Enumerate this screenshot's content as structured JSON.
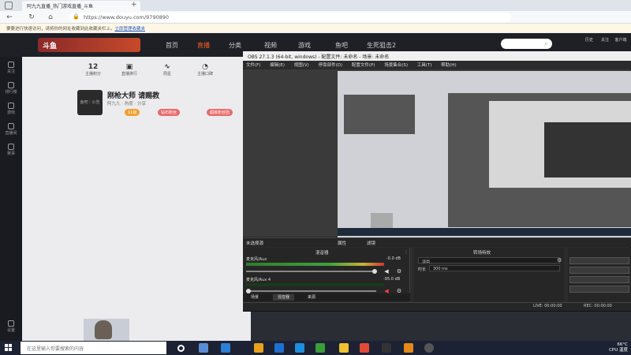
{
  "browser": {
    "tab_title": "阿九九直播_热门游戏直播_斗鱼",
    "url": "https://www.douyu.com/9790890",
    "notice_text": "要要进行快速访问，请将你的网址收藏到此收藏夹栏上。",
    "notice_link": "立即管理收藏夹"
  },
  "douyu": {
    "logo": "斗鱼",
    "nav": [
      "首页",
      "直播",
      "分类",
      "视频",
      "游戏",
      "鱼吧",
      "生死狙击2"
    ],
    "search_placeholder": "",
    "sidebar": [
      "关注",
      "排行榜",
      "游戏",
      "直播间",
      "赛事",
      "设置"
    ],
    "stats": [
      {
        "value": "12",
        "label": "主播积分"
      },
      {
        "value": "",
        "label": "直播排行"
      },
      {
        "value": "",
        "label": "周星"
      },
      {
        "value": "",
        "label": "主播口碑"
      }
    ],
    "room_title": "刚枪大师 请赐教",
    "room_sub": "阿九九  ·  热度  ·  分享",
    "avatar_text": "鱼吧｜公告",
    "tags": [
      "11级",
      "钻石粉丝",
      "超级粉丝团"
    ],
    "right_icons": [
      "历史",
      "关注",
      "客户端"
    ]
  },
  "obs": {
    "title": "OBS 27.1.3 (64-bit, windows) - 配置文件: 未命名 - 场景: 未命名",
    "menu": [
      "文件(F)",
      "编辑(E)",
      "视图(V)",
      "停靠部件(D)",
      "配置文件(P)",
      "场景集合(S)",
      "工具(T)",
      "帮助(H)"
    ],
    "no_source": "未选择源",
    "props_label": "属性",
    "filters_label": "滤镜",
    "mixer_title": "混音器",
    "transition_title": "转场特效",
    "channels": [
      {
        "name": "麦克风/Aux",
        "db": "-0.0 dB"
      },
      {
        "name": "麦克风/Aux 4",
        "db": "-95.0 dB"
      }
    ],
    "transition_type": "淡出",
    "duration_label": "时长",
    "duration_value": "300 ms",
    "tabs": [
      "场景",
      "混音器",
      "来源"
    ],
    "live": "LIVE: 00:00:00",
    "rec": "REC: 00:00:00",
    "cpu": "CPU: 2.0%"
  },
  "taskbar": {
    "search_placeholder": "在这里输入你要搜索的内容",
    "weather": "66°C",
    "cpu_label": "CPU 温度"
  },
  "colors": {
    "accent": "#ff5d23",
    "obs_bg": "#2b2b2b",
    "taskbar": "#1c2233"
  }
}
